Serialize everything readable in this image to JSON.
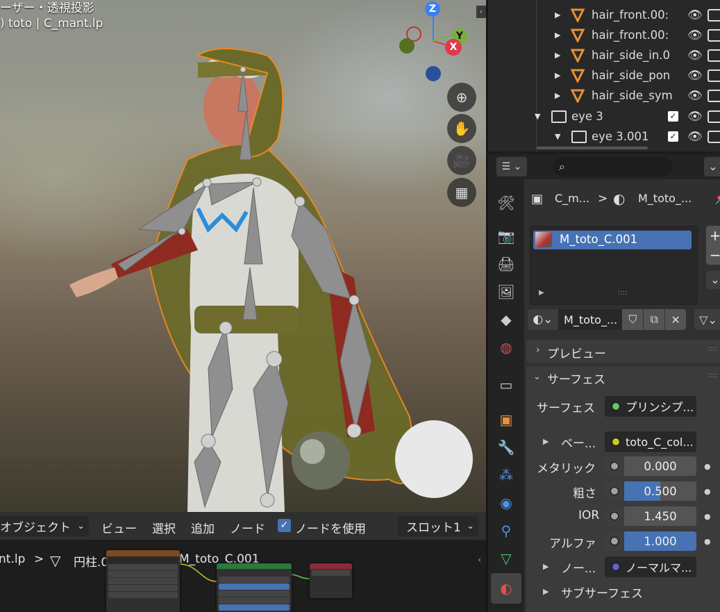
{
  "viewport": {
    "line1": "ーザー・透視投影",
    "line2": ") toto | C_mant.lp",
    "gizmo": {
      "z": "Z",
      "y": "Y",
      "x": "X"
    }
  },
  "outliner": {
    "rows": [
      {
        "label": "hair_front.00:"
      },
      {
        "label": "hair_front.00:"
      },
      {
        "label": "hair_side_in.0"
      },
      {
        "label": "hair_side_pon"
      },
      {
        "label": "hair_side_sym"
      },
      {
        "label": "eye 3"
      },
      {
        "label": "eye 3.001"
      }
    ]
  },
  "properties": {
    "breadcrumb": {
      "object": "C_m...",
      "material": "M_toto_..."
    },
    "slot_item": "M_toto_C.001",
    "material_name": "M_toto_...",
    "panels": {
      "preview": "プレビュー",
      "surface": "サーフェス",
      "subsurface": "サブサーフェス"
    },
    "surface": {
      "surface_label": "サーフェス",
      "surface_value": "プリンシプ...",
      "base_label": "ベー...",
      "base_value": "toto_C_col...",
      "metallic_label": "メタリック",
      "metallic_value": "0.000",
      "roughness_label": "粗さ",
      "roughness_value": "0.500",
      "roughness_fill": 0.5,
      "ior_label": "IOR",
      "ior_value": "1.450",
      "alpha_label": "アルファ",
      "alpha_value": "1.000",
      "alpha_fill": 1.0,
      "normal_label": "ノー...",
      "normal_value": "ノーマルマ..."
    },
    "colors": {
      "accent": "#4772b3",
      "socket_green": "#63c763",
      "socket_yellow": "#c7c729",
      "socket_purple": "#6363c7"
    }
  },
  "node_editor": {
    "mode": "オブジェクト",
    "menus": [
      "ビュー",
      "選択",
      "追加",
      "ノード"
    ],
    "use_nodes": "ノードを使用",
    "slot": "スロット1",
    "breadcrumb": {
      "file": "nt.lp",
      "mesh": "円柱.004",
      "material": "M_toto_C.001"
    }
  }
}
